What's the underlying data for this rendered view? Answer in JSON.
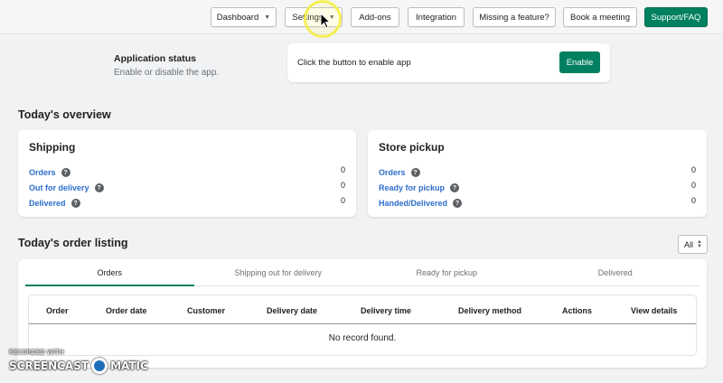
{
  "topnav": {
    "dashboard": "Dashboard",
    "settings": "Settings",
    "addons": "Add-ons",
    "integration": "Integration",
    "missing_feature": "Missing a feature?",
    "book_meeting": "Book a meeting",
    "support": "Support/FAQ"
  },
  "app_status": {
    "title": "Application status",
    "description": "Enable or disable the app.",
    "card_text": "Click the button to enable app",
    "enable_label": "Enable"
  },
  "overview": {
    "title": "Today's overview",
    "shipping": {
      "title": "Shipping",
      "rows": [
        {
          "label": "Orders",
          "value": "0"
        },
        {
          "label": "Out for delivery",
          "value": "0"
        },
        {
          "label": "Delivered",
          "value": "0"
        }
      ]
    },
    "store_pickup": {
      "title": "Store pickup",
      "rows": [
        {
          "label": "Orders",
          "value": "0"
        },
        {
          "label": "Ready for pickup",
          "value": "0"
        },
        {
          "label": "Handed/Delivered",
          "value": "0"
        }
      ]
    }
  },
  "listing": {
    "title": "Today's order listing",
    "filter_value": "All",
    "tabs": [
      "Orders",
      "Shipping out for delivery",
      "Ready for pickup",
      "Delivered"
    ],
    "columns": [
      "Order",
      "Order date",
      "Customer",
      "Delivery date",
      "Delivery time",
      "Delivery method",
      "Actions",
      "View details"
    ],
    "empty_message": "No record found."
  },
  "watermark": {
    "line1": "RECORDED WITH",
    "line2a": "SCREENCAST",
    "line2b": "MATIC"
  },
  "colors": {
    "primary": "#008060",
    "link": "#2c6ecb",
    "background": "#f1f2f3"
  }
}
